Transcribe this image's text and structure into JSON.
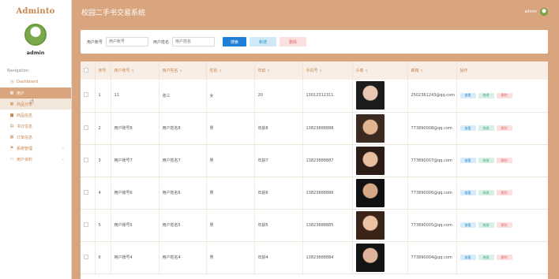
{
  "brand": "Adminto",
  "user": {
    "name": "admin"
  },
  "nav_title": "Navigation",
  "nav": [
    {
      "label": "Dashboard",
      "icon": "clock-icon",
      "glyph": "◷",
      "state": ""
    },
    {
      "label": "用户",
      "icon": "grid-icon",
      "glyph": "▦",
      "state": "active"
    },
    {
      "label": "商品分类",
      "icon": "grid-icon",
      "glyph": "▦",
      "state": "hover"
    },
    {
      "label": "商品信息",
      "icon": "folder-icon",
      "glyph": "▆",
      "state": ""
    },
    {
      "label": "书订信息",
      "icon": "book-icon",
      "glyph": "▤",
      "state": ""
    },
    {
      "label": "订单信息",
      "icon": "list-icon",
      "glyph": "▦",
      "state": ""
    },
    {
      "label": "系统管理",
      "icon": "flag-icon",
      "glyph": "⚑",
      "state": "",
      "expandable": true
    },
    {
      "label": "用户资料",
      "icon": "calendar-icon",
      "glyph": "▭",
      "state": "",
      "expandable": true
    }
  ],
  "header": {
    "title": "校园二手书交易系统",
    "user_name": "admin"
  },
  "search": {
    "account_label": "用户账号",
    "account_placeholder": "用户账号",
    "name_label": "用户姓名",
    "name_placeholder": "用户姓名",
    "search_btn": "搜索",
    "add_btn": "新增",
    "delete_btn": "删除"
  },
  "table": {
    "columns": [
      "",
      "序号",
      "用户账号",
      "用户姓名",
      "性别",
      "年龄",
      "手机号",
      "头像",
      "邮箱",
      "操作"
    ],
    "ops": {
      "view": "查看",
      "edit": "修改",
      "delete": "删除"
    },
    "rows": [
      {
        "index": "1",
        "account": "11",
        "name": "张三",
        "gender": "女",
        "age": "20",
        "phone": "13012312311",
        "email": "2502361243@qq.com",
        "avatar": "avatar-1"
      },
      {
        "index": "2",
        "account": "用户账号8",
        "name": "用户姓名8",
        "gender": "男",
        "age": "年龄8",
        "phone": "13823888888",
        "email": "773890008@qq.com",
        "avatar": "avatar-2"
      },
      {
        "index": "3",
        "account": "用户账号7",
        "name": "用户姓名7",
        "gender": "男",
        "age": "年龄7",
        "phone": "13823888887",
        "email": "773890007@qq.com",
        "avatar": "avatar-3"
      },
      {
        "index": "4",
        "account": "用户账号6",
        "name": "用户姓名6",
        "gender": "男",
        "age": "年龄6",
        "phone": "13823888886",
        "email": "773890006@qq.com",
        "avatar": "avatar-4"
      },
      {
        "index": "5",
        "account": "用户账号5",
        "name": "用户姓名5",
        "gender": "男",
        "age": "年龄5",
        "phone": "13823888885",
        "email": "773890005@qq.com",
        "avatar": "avatar-5"
      },
      {
        "index": "6",
        "account": "用户账号4",
        "name": "用户姓名4",
        "gender": "男",
        "age": "年龄4",
        "phone": "13823888884",
        "email": "773890004@qq.com",
        "avatar": "avatar-6"
      }
    ]
  },
  "colors": {
    "accent": "#d9a57e",
    "brand": "#c8874d",
    "primary_btn": "#1e7fd8"
  }
}
